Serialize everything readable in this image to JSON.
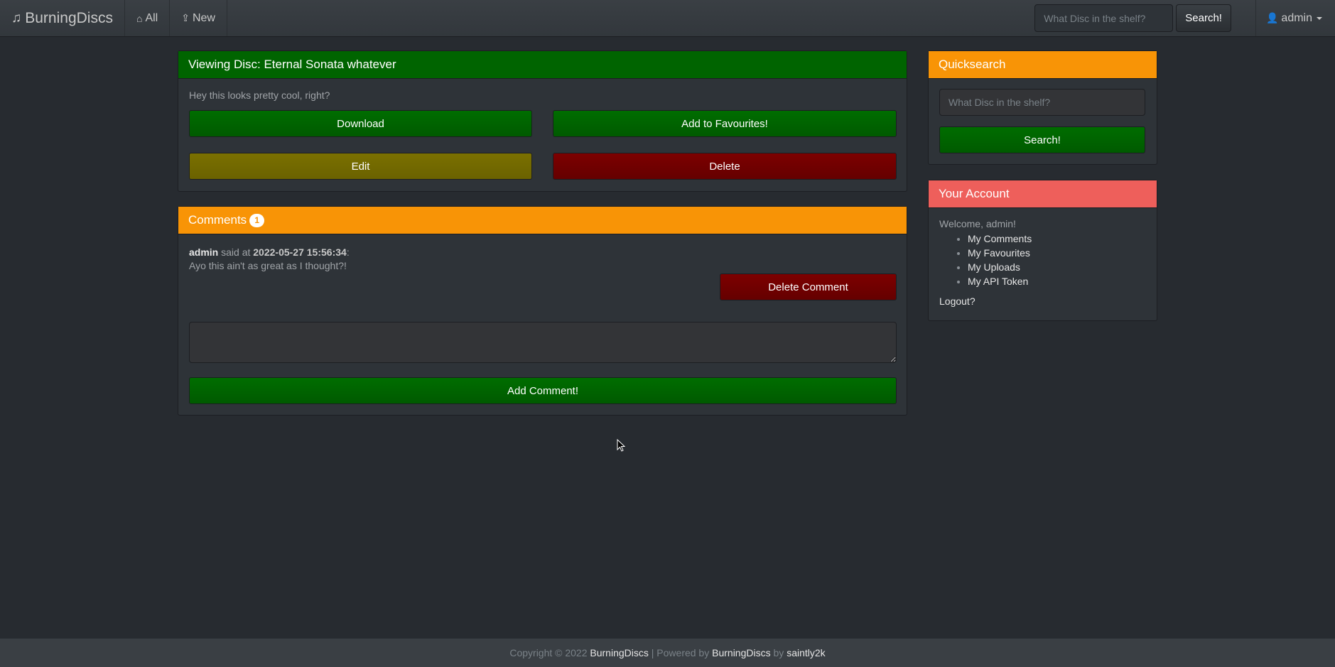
{
  "navbar": {
    "brand": "BurningDiscs",
    "brand_icon": "music-note-icon",
    "links": [
      {
        "label": "All",
        "icon": "home-icon"
      },
      {
        "label": "New",
        "icon": "upload-icon"
      }
    ],
    "search_placeholder": "What Disc in the shelf?",
    "search_button": "Search!",
    "user": "admin"
  },
  "disc": {
    "heading": "Viewing Disc: Eternal Sonata whatever",
    "description": "Hey this looks pretty cool, right?",
    "download_label": "Download",
    "favourite_label": "Add to Favourites!",
    "edit_label": "Edit",
    "delete_label": "Delete"
  },
  "comments": {
    "heading": "Comments",
    "count": "1",
    "items": [
      {
        "author": "admin",
        "said_at": "said at",
        "timestamp": "2022-05-27 15:56:34",
        "text": "Ayo this ain't as great as I thought?!",
        "delete_label": "Delete Comment"
      }
    ],
    "add_label": "Add Comment!"
  },
  "quicksearch": {
    "heading": "Quicksearch",
    "placeholder": "What Disc in the shelf?",
    "button": "Search!"
  },
  "account": {
    "heading": "Your Account",
    "welcome": "Welcome, admin!",
    "links": [
      "My Comments",
      "My Favourites",
      "My Uploads",
      "My API Token"
    ],
    "logout": "Logout?"
  },
  "footer": {
    "copyright": "Copyright © 2022",
    "brand": "BurningDiscs",
    "powered_by": "| Powered by",
    "powered_brand": "BurningDiscs",
    "by": "by",
    "author": "saintly2k"
  },
  "colors": {
    "green": "#006400",
    "orange": "#f89406",
    "red_heading": "#ee5f5b",
    "danger": "#7d0000",
    "warning": "#7a7000"
  }
}
